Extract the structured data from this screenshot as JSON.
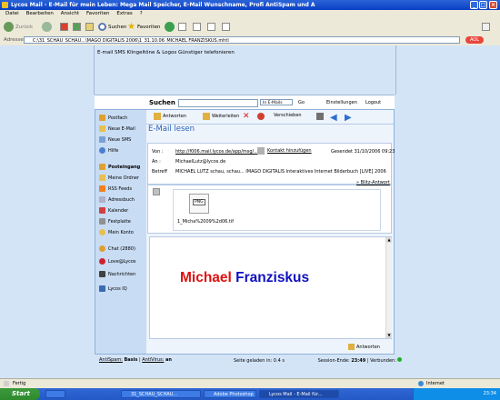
{
  "window": {
    "title": "Lycos Mail - E-Mail für mein Leben: Mega Mail Speicher, E-Mail Wunschname, Profi AntiSpam und A"
  },
  "menu": [
    "Datei",
    "Bearbeiten",
    "Ansicht",
    "Favoriten",
    "Extras",
    "?"
  ],
  "toolbar": {
    "back": "Zurück",
    "search": "Suchen",
    "favorites": "Favoriten"
  },
  "address": {
    "label": "Adresse",
    "url": "C:\\31_SCHAU_SCHAU...\\MAGO DIGITALIS 2006\\1_31.10.06_MICHAEL FRANZISKUS.mhtl",
    "go": "Go"
  },
  "top_links": "E-mail  SMS  Klingeltöne & Logos  Günstiger telefonieren",
  "search": {
    "label": "Suchen",
    "scope": "In E-Mails",
    "go": "Go",
    "settings": "Einstellungen",
    "logout": "Logout"
  },
  "sidebar": [
    {
      "label": "Postfach",
      "icon": "mailbox-icon"
    },
    {
      "label": "Neue E-Mail",
      "icon": "new-mail-icon"
    },
    {
      "label": "Neue SMS",
      "icon": "new-sms-icon"
    },
    {
      "label": "Hilfe",
      "icon": "help-icon"
    },
    {
      "label": "Posteingang",
      "icon": "inbox-icon"
    },
    {
      "label": "Meine Ordner",
      "icon": "folder-icon"
    },
    {
      "label": "RSS Feeds",
      "icon": "rss-icon"
    },
    {
      "label": "Adressbuch",
      "icon": "addressbook-icon"
    },
    {
      "label": "Kalender",
      "icon": "calendar-icon"
    },
    {
      "label": "Festplatte",
      "icon": "harddisk-icon"
    },
    {
      "label": "Mein Konto",
      "icon": "account-icon"
    },
    {
      "label": "Chat (2880)",
      "icon": "chat-icon"
    },
    {
      "label": "Love@Lycos",
      "icon": "love-icon"
    },
    {
      "label": "Nachrichten",
      "icon": "news-icon"
    },
    {
      "label": "Lycos IQ",
      "icon": "iq-icon"
    }
  ],
  "actions": {
    "reply": "Antworten",
    "forward": "Weiterleiten",
    "move": "Verschieben"
  },
  "mail": {
    "heading": "E-Mail lesen",
    "from_label": "Von :",
    "from": "http://f006.mail.lycos.de/app/msg/...",
    "add_contact": "Kontakt hinzufügen",
    "sent": "Gesendet 31/10/2006 09:23",
    "to_label": "An :",
    "to": "MichaelLutz@lycos.de",
    "subject_label": "Betreff",
    "subject": "MICHAEL LUTZ schau, schau... IMAGO DIGITALIS Interaktives Internet Bilderbuch [LIVE] 2006",
    "quick_reply": "Blitz-Antwort",
    "attachment_type": "PNG",
    "attachment": "1_Micha%2009%2d06.tif",
    "body_first": "Michael",
    "body_last": "Franziskus",
    "reply_bottom": "Antworten"
  },
  "footer": {
    "antispam": "AntiSpam:",
    "antispam_val": "Basis",
    "antivirus": "AntiVirus:",
    "antivirus_val": "an",
    "page_loaded": "Seite geladen in: 0.4 s",
    "session": "Session-Ende:",
    "session_time": "23:49",
    "connected": "Verbunden:"
  },
  "status": {
    "left": "Fertig",
    "right": "Internet"
  },
  "taskbar": {
    "start": "Start",
    "tasks": [
      "31_SCHAU_SCHAU...",
      "Adobe Photoshop",
      "Lycos Mail - E-Mail für..."
    ],
    "time": "23:34"
  }
}
